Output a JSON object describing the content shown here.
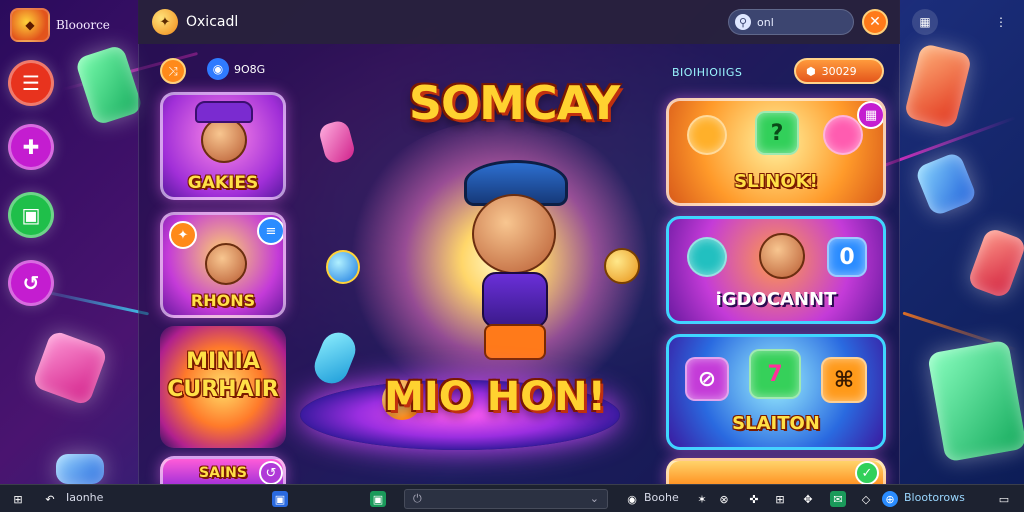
{
  "brand": {
    "name": "Blooorce"
  },
  "window": {
    "title": "Oxicadl"
  },
  "search": {
    "value": "onl"
  },
  "toolbar": {
    "count_label": "9O8G"
  },
  "left_cards": [
    {
      "label": "GAKIES"
    },
    {
      "label": "RHONS"
    },
    {
      "label": "MINIA\nCURHAIR"
    },
    {
      "label": "SAINS"
    }
  ],
  "hero": {
    "title": "SOMCAY",
    "cta": "MIO HON!"
  },
  "right_panel": {
    "section_label": "BIOIHIOIIGS",
    "coins": "30029",
    "cards": [
      {
        "label": "SLINOK!"
      },
      {
        "label": "iGDOCANNT"
      },
      {
        "label": "SLAITON"
      }
    ]
  },
  "taskbar": {
    "left_label": "Iaonhe",
    "status_label": "Boohe",
    "right_label": "Blootorows"
  },
  "colors": {
    "accent_orange": "#ff7a1a",
    "gold_text": "#ffd230",
    "rail_red": "#e8331e",
    "rail_magenta": "#c41dd0",
    "rail_green": "#1fbf4a"
  },
  "icons": [
    "menu-icon",
    "puzzle-icon",
    "controller-icon",
    "refresh-icon",
    "search-icon",
    "close-icon",
    "coin-icon",
    "kebab-menu-icon"
  ]
}
